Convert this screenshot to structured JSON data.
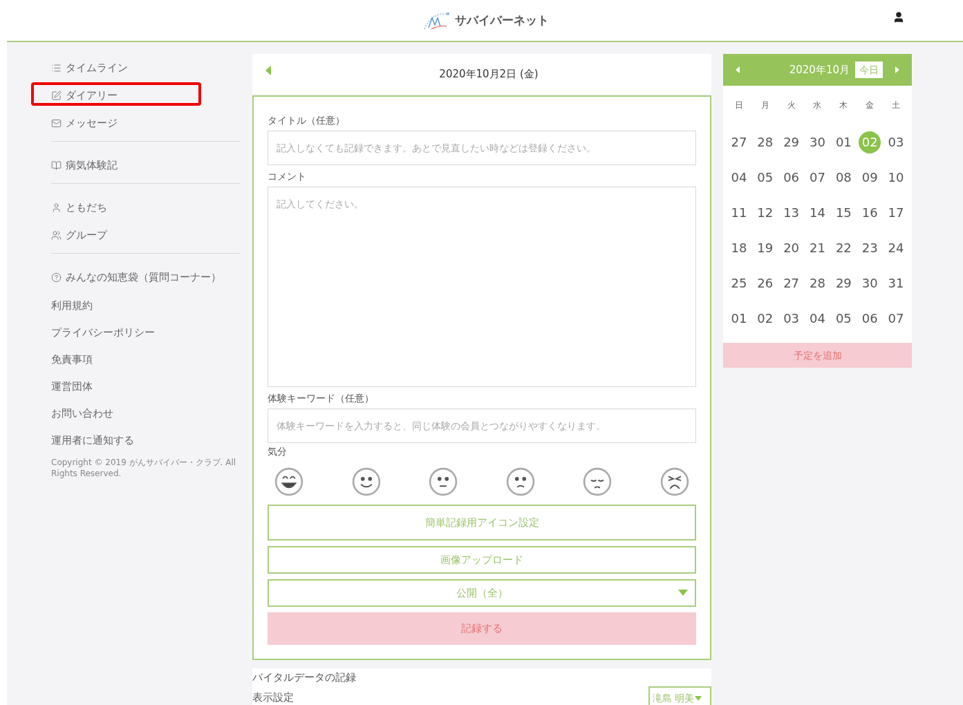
{
  "header": {
    "logo_text": "サバイバーネット"
  },
  "sidebar": {
    "sections": [
      [
        {
          "label": "タイムライン",
          "kind": "list",
          "highlighted": false
        },
        {
          "label": "ダイアリー",
          "kind": "edit",
          "highlighted": true
        },
        {
          "label": "メッセージ",
          "kind": "mail",
          "highlighted": false
        }
      ],
      [
        {
          "label": "病気体験記",
          "kind": "book",
          "highlighted": false
        }
      ],
      [
        {
          "label": "ともだち",
          "kind": "user",
          "highlighted": false
        },
        {
          "label": "グループ",
          "kind": "group",
          "highlighted": false
        }
      ],
      [
        {
          "label": "みんなの知恵袋（質問コーナー）",
          "kind": "question",
          "highlighted": false
        }
      ]
    ],
    "links": [
      "利用規約",
      "プライバシーポリシー",
      "免責事項",
      "運営団体",
      "お問い合わせ",
      "運用者に通知する"
    ],
    "copyright": "Copyright © 2019 がんサバイバー・クラブ. All Rights Reserved."
  },
  "diary": {
    "date": "2020年10月2日 (金)",
    "title_label": "タイトル（任意）",
    "title_placeholder": "記入しなくても記録できます。あとで見直したい時などは登録ください。",
    "comment_label": "コメント",
    "comment_placeholder": "記入してください。",
    "keyword_label": "体験キーワード（任意）",
    "keyword_placeholder": "体験キーワードを入力すると、同じ体験の会員とつながりやすくなります。",
    "mood_label": "気分",
    "moods": [
      {
        "kind": "laugh",
        "selected": false
      },
      {
        "kind": "smile",
        "selected": false
      },
      {
        "kind": "neutral",
        "selected": false
      },
      {
        "kind": "worried",
        "selected": false
      },
      {
        "kind": "sad",
        "selected": false
      },
      {
        "kind": "angry",
        "selected": false
      }
    ],
    "icon_settings_button": "簡単記録用アイコン設定",
    "upload_button": "画像アップロード",
    "visibility_select": "公開（全）",
    "submit_button": "記録する"
  },
  "vitals": {
    "title": "バイタルデータの記録",
    "display_label": "表示設定",
    "person_select": "滝島 明美"
  },
  "calendar": {
    "month": "2020年10月",
    "today_button": "今日",
    "weekdays": [
      "日",
      "月",
      "火",
      "水",
      "木",
      "金",
      "土"
    ],
    "weeks": [
      [
        {
          "day": "27",
          "selected": false
        },
        {
          "day": "28",
          "selected": false
        },
        {
          "day": "29",
          "selected": false
        },
        {
          "day": "30",
          "selected": false
        },
        {
          "day": "01",
          "selected": false
        },
        {
          "day": "02",
          "selected": true
        },
        {
          "day": "03",
          "selected": false
        }
      ],
      [
        {
          "day": "04",
          "selected": false
        },
        {
          "day": "05",
          "selected": false
        },
        {
          "day": "06",
          "selected": false
        },
        {
          "day": "07",
          "selected": false
        },
        {
          "day": "08",
          "selected": false
        },
        {
          "day": "09",
          "selected": false
        },
        {
          "day": "10",
          "selected": false
        }
      ],
      [
        {
          "day": "11",
          "selected": false
        },
        {
          "day": "12",
          "selected": false
        },
        {
          "day": "13",
          "selected": false
        },
        {
          "day": "14",
          "selected": false
        },
        {
          "day": "15",
          "selected": false
        },
        {
          "day": "16",
          "selected": false
        },
        {
          "day": "17",
          "selected": false
        }
      ],
      [
        {
          "day": "18",
          "selected": false
        },
        {
          "day": "19",
          "selected": false
        },
        {
          "day": "20",
          "selected": false
        },
        {
          "day": "21",
          "selected": false
        },
        {
          "day": "22",
          "selected": false
        },
        {
          "day": "23",
          "selected": false
        },
        {
          "day": "24",
          "selected": false
        }
      ],
      [
        {
          "day": "25",
          "selected": false
        },
        {
          "day": "26",
          "selected": false
        },
        {
          "day": "27",
          "selected": false
        },
        {
          "day": "28",
          "selected": false
        },
        {
          "day": "29",
          "selected": false
        },
        {
          "day": "30",
          "selected": false
        },
        {
          "day": "31",
          "selected": false
        }
      ],
      [
        {
          "day": "01",
          "selected": false
        },
        {
          "day": "02",
          "selected": false
        },
        {
          "day": "03",
          "selected": false
        },
        {
          "day": "04",
          "selected": false
        },
        {
          "day": "05",
          "selected": false
        },
        {
          "day": "06",
          "selected": false
        },
        {
          "day": "07",
          "selected": false
        }
      ]
    ],
    "add_button": "予定を追加"
  }
}
